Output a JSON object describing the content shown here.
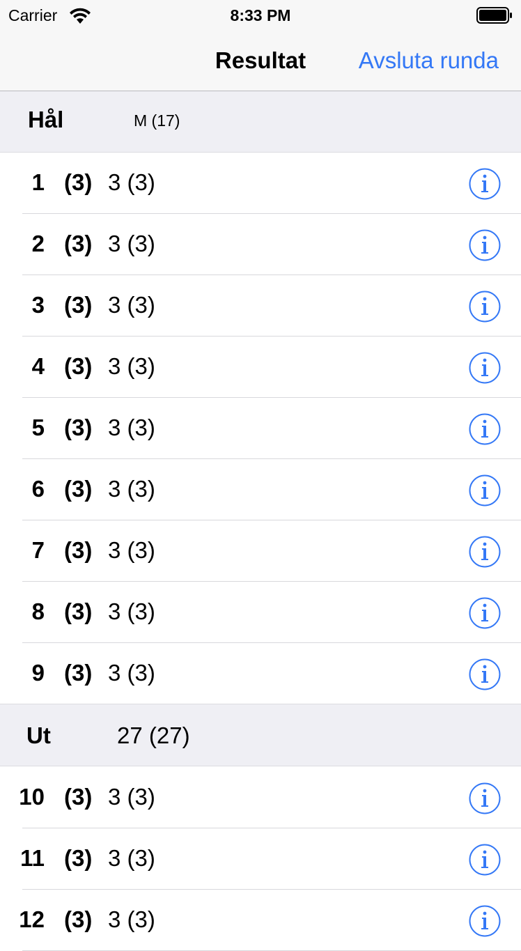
{
  "status_bar": {
    "carrier": "Carrier",
    "time": "8:33 PM"
  },
  "nav": {
    "title": "Resultat",
    "action_label": "Avsluta runda"
  },
  "sections": [
    {
      "header_label": "Hål",
      "header_value": "M (17)",
      "rows": [
        {
          "hole": "1",
          "par": "(3)",
          "score": "3 (3)"
        },
        {
          "hole": "2",
          "par": "(3)",
          "score": "3 (3)"
        },
        {
          "hole": "3",
          "par": "(3)",
          "score": "3 (3)"
        },
        {
          "hole": "4",
          "par": "(3)",
          "score": "3 (3)"
        },
        {
          "hole": "5",
          "par": "(3)",
          "score": "3 (3)"
        },
        {
          "hole": "6",
          "par": "(3)",
          "score": "3 (3)"
        },
        {
          "hole": "7",
          "par": "(3)",
          "score": "3 (3)"
        },
        {
          "hole": "8",
          "par": "(3)",
          "score": "3 (3)"
        },
        {
          "hole": "9",
          "par": "(3)",
          "score": "3 (3)"
        }
      ]
    },
    {
      "header_label": "Ut",
      "header_value": "27 (27)",
      "rows": [
        {
          "hole": "10",
          "par": "(3)",
          "score": "3 (3)"
        },
        {
          "hole": "11",
          "par": "(3)",
          "score": "3 (3)"
        },
        {
          "hole": "12",
          "par": "(3)",
          "score": "3 (3)"
        }
      ]
    }
  ],
  "colors": {
    "accent": "#3478f6",
    "section_background": "#efeff4",
    "bar_background": "#f7f7f7"
  },
  "icons": {
    "row_action": "info-circle-icon",
    "wifi": "wifi-icon",
    "battery": "battery-icon"
  }
}
